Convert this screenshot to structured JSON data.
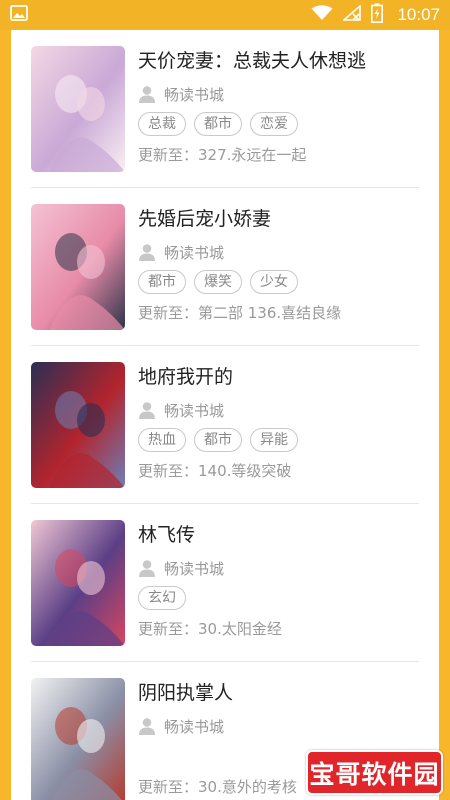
{
  "status_bar": {
    "time": "10:07",
    "icons": [
      "image-icon",
      "wifi-icon",
      "signal-icon",
      "battery-icon"
    ]
  },
  "books": [
    {
      "title": "天价宠妻：总裁夫人休想逃",
      "source": "畅读书城",
      "tags": [
        "总裁",
        "都市",
        "恋爱"
      ],
      "update": "更新至：327.永远在一起",
      "cover_colors": [
        "#f4d7e5",
        "#c9a9d6",
        "#f9eef4"
      ]
    },
    {
      "title": "先婚后宠小娇妻",
      "source": "畅读书城",
      "tags": [
        "都市",
        "爆笑",
        "少女"
      ],
      "update": "更新至：第二部 136.喜结良缘",
      "cover_colors": [
        "#f4c2d4",
        "#e88ba8",
        "#2d3448"
      ]
    },
    {
      "title": "地府我开的",
      "source": "畅读书城",
      "tags": [
        "热血",
        "都市",
        "异能"
      ],
      "update": "更新至：140.等级突破",
      "cover_colors": [
        "#2a2f55",
        "#b3242d",
        "#6d7fb8"
      ]
    },
    {
      "title": "林飞传",
      "source": "畅读书城",
      "tags": [
        "玄幻"
      ],
      "update": "更新至：30.太阳金经",
      "cover_colors": [
        "#f0c7d4",
        "#5b3f86",
        "#d9455f"
      ]
    },
    {
      "title": "阴阳执掌人",
      "source": "畅读书城",
      "tags": [],
      "update": "更新至：30.意外的考核",
      "cover_colors": [
        "#f2f2f2",
        "#8a8fa6",
        "#b63a2e"
      ]
    }
  ],
  "watermark": {
    "text": "宝哥软件园"
  },
  "colors": {
    "accent": "#f8b62a",
    "divider": "#e6e6e6",
    "tag_border": "#c9c9c9"
  }
}
